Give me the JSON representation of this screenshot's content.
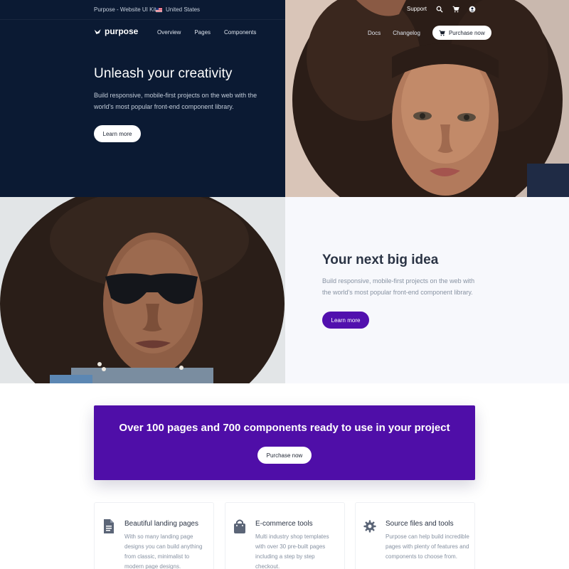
{
  "topbar": {
    "brand_line": "Purpose - Website UI Kit",
    "locale": "United States",
    "support": "Support",
    "icons": [
      "search-icon",
      "cart-icon",
      "user-icon"
    ]
  },
  "navbar": {
    "logo": "purpose",
    "links": [
      "Overview",
      "Pages",
      "Components"
    ],
    "right_links": [
      "Docs",
      "Changelog"
    ],
    "purchase": "Purchase now"
  },
  "hero": {
    "title": "Unleash your creativity",
    "text": "Build responsive, mobile-first projects on the web with the world's most popular front-end component library.",
    "button": "Learn more"
  },
  "feature": {
    "title": "Your next big idea",
    "text": "Build responsive, mobile-first projects on the web with the world's most popular front-end component library.",
    "button": "Learn more"
  },
  "cta": {
    "title": "Over 100 pages and 700 components ready to use in your project",
    "button": "Purchase now"
  },
  "cards": [
    {
      "icon": "document-icon",
      "title": "Beautiful landing pages",
      "text": "With so many landing page designs you can build anything from classic, minimalist to modern page designs."
    },
    {
      "icon": "shopping-bag-icon",
      "title": "E-commerce tools",
      "text": "Multi industry shop templates with over 30 pre-built pages including a step by step checkout."
    },
    {
      "icon": "gear-icon",
      "title": "Source files and tools",
      "text": "Purpose can help build incredible pages with plenty of features and components to choose from."
    }
  ],
  "colors": {
    "navy": "#0b1a33",
    "purple": "#4f0ea8",
    "button_purple": "#5210ae",
    "light_bg": "#f7f8fc",
    "icon_gray": "#5b6577"
  }
}
